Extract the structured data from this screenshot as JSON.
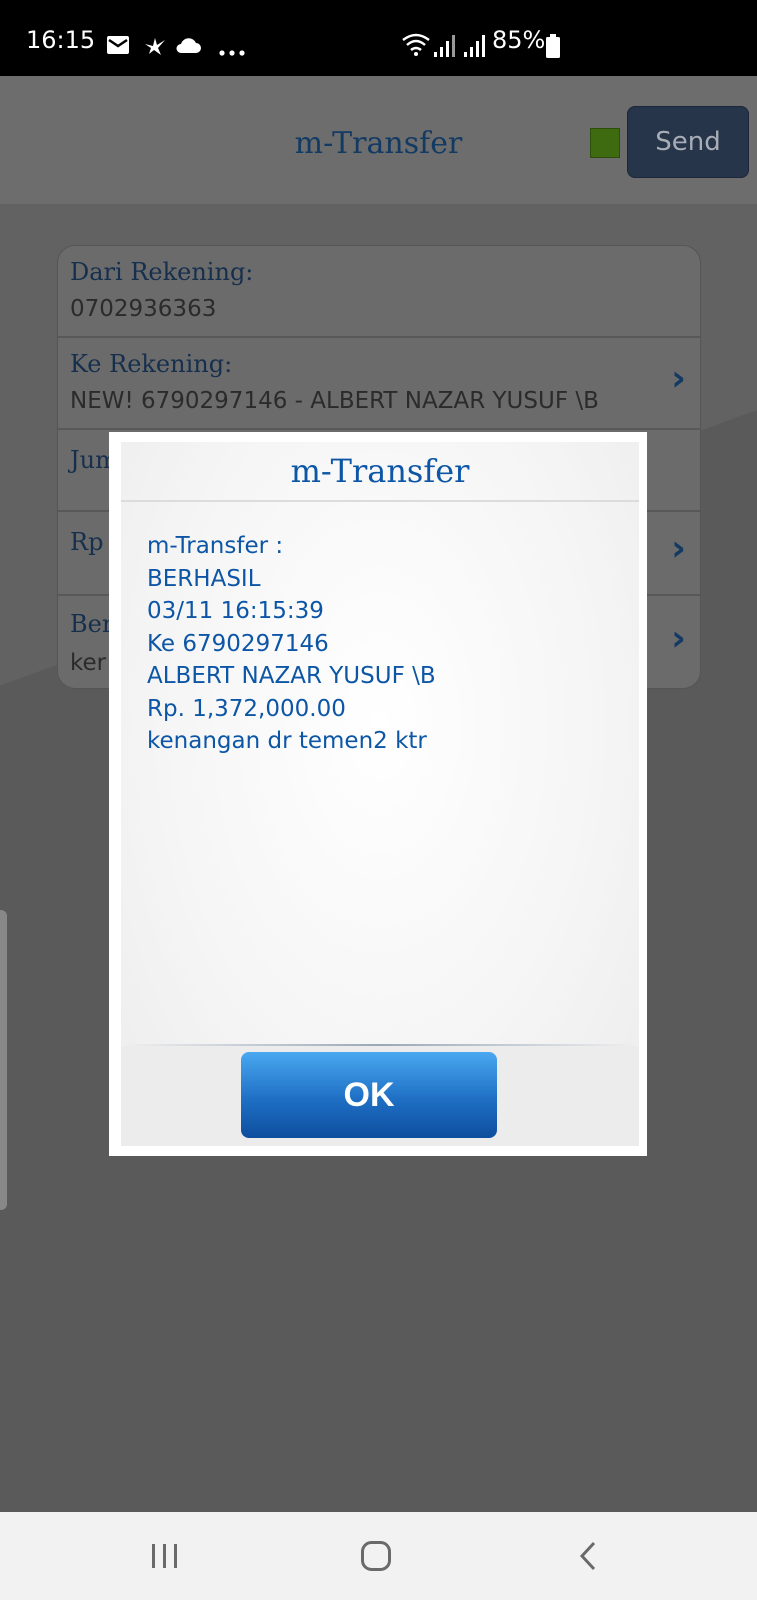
{
  "status_bar": {
    "time": "16:15",
    "battery": "85%",
    "icons": [
      "mail-icon",
      "bird-icon",
      "cloud-icon",
      "more-dots-icon",
      "wifi-icon",
      "signal-icon",
      "signal-icon",
      "battery-icon"
    ]
  },
  "header": {
    "title": "m-Transfer",
    "send_label": "Send",
    "indicator_color": "#3f6b10"
  },
  "form": {
    "rows": [
      {
        "label": "Dari Rekening:",
        "value": "0702936363"
      },
      {
        "label": "Ke Rekening:",
        "value": "NEW! 6790297146 - ALBERT NAZAR YUSUF \\B"
      },
      {
        "label": "Jum",
        "value": ""
      },
      {
        "label": "Rp",
        "value": ""
      },
      {
        "label": "Ber",
        "value": "ker"
      }
    ]
  },
  "dialog": {
    "title": "m-Transfer",
    "lines": [
      "m-Transfer :",
      "BERHASIL",
      "03/11 16:15:39",
      "Ke 6790297146",
      "ALBERT NAZAR YUSUF \\B",
      "Rp. 1,372,000.00",
      "kenangan dr temen2 ktr"
    ],
    "ok_label": "OK",
    "accent": "#0d56a6"
  },
  "nav_bar": {
    "icons": [
      "recent-apps-icon",
      "home-icon",
      "back-icon"
    ]
  }
}
